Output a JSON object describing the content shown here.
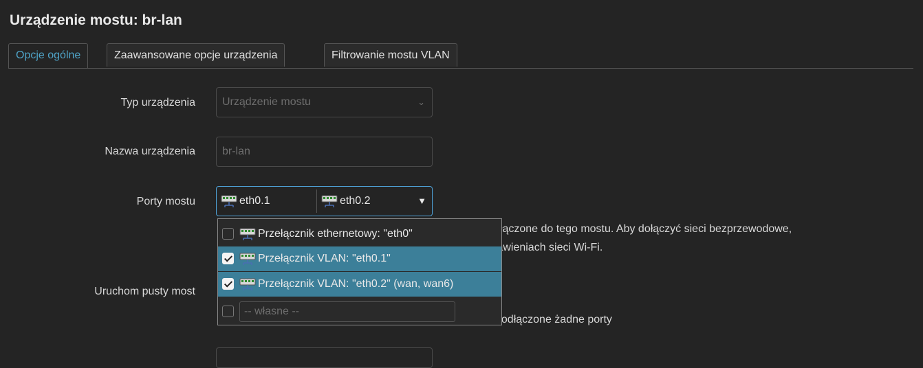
{
  "page": {
    "title": "Urządzenie mostu: br-lan"
  },
  "tabs": [
    {
      "label": "Opcje ogólne",
      "active": true
    },
    {
      "label": "Zaawansowane opcje urządzenia",
      "active": false
    },
    {
      "label": "Filtrowanie mostu VLAN",
      "active": false
    }
  ],
  "form": {
    "device_type": {
      "label": "Typ urządzenia",
      "value": "Urządzenie mostu"
    },
    "device_name": {
      "label": "Nazwa urządzenia",
      "value": "br-lan"
    },
    "bridge_ports": {
      "label": "Porty mostu",
      "selected": [
        "eth0.1",
        "eth0.2"
      ],
      "help_right_line1": "ołączone do tego mostu. Aby dołączyć sieci bezprzewodowe,",
      "help_right_line2": "tawieniach sieci Wi-Fi."
    },
    "empty_bridge": {
      "label": "Uruchom pusty most",
      "help_right": "podłączone żadne porty"
    }
  },
  "dropdown": {
    "options": [
      {
        "label": "Przełącznik ethernetowy: \"eth0\"",
        "checked": false,
        "highlighted": false
      },
      {
        "label": "Przełącznik VLAN: \"eth0.1\"",
        "checked": true,
        "highlighted": true
      },
      {
        "label": "Przełącznik VLAN: \"eth0.2\" (wan, wan6)",
        "checked": true,
        "highlighted": true
      }
    ],
    "custom_placeholder": "-- własne --"
  },
  "colors": {
    "accent": "#4fa3c7",
    "selected_row": "#3c7f99",
    "background": "#242424"
  },
  "icons": {
    "port": "network-switch-icon",
    "chevron": "chevron-down-icon",
    "caret": "caret-down-icon"
  }
}
